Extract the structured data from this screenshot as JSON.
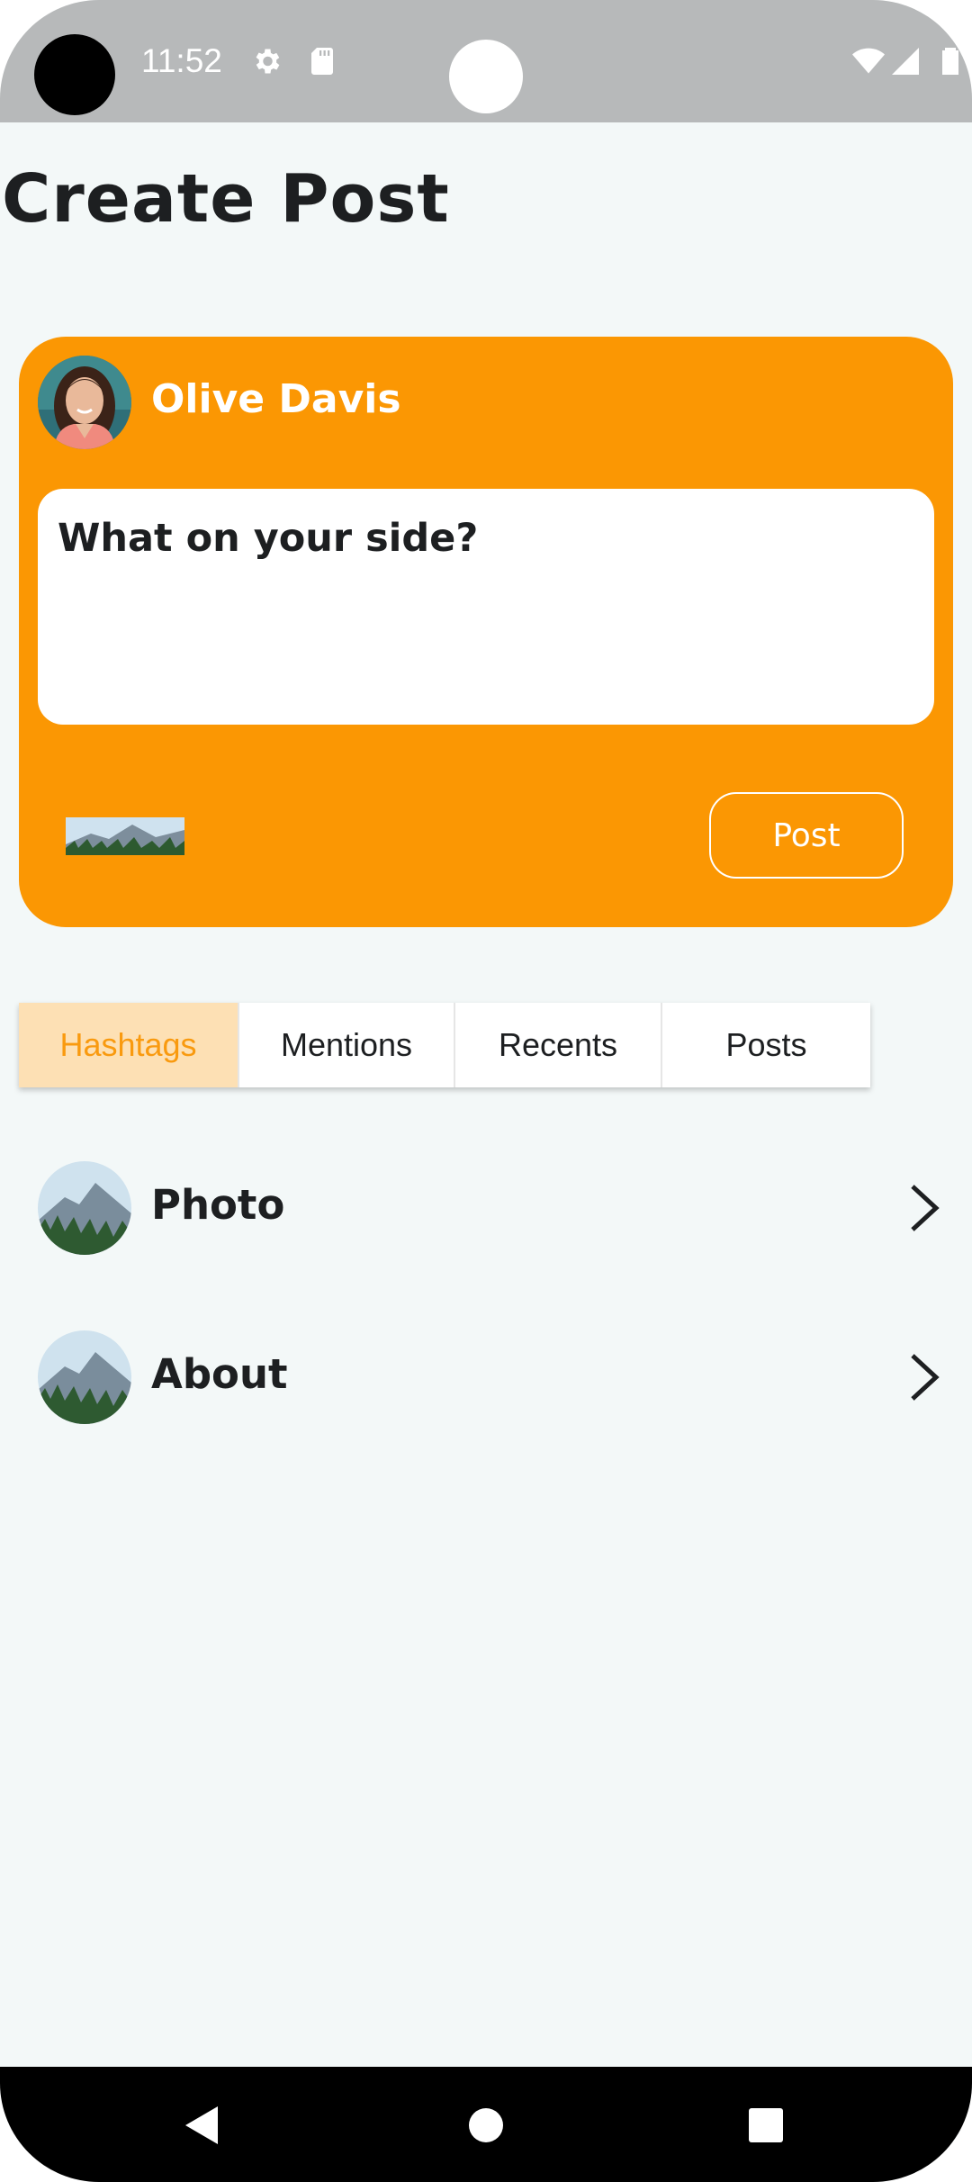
{
  "status_bar": {
    "time": "11:52",
    "icons": [
      "settings-icon",
      "sd-card-icon",
      "wifi-icon",
      "signal-icon",
      "battery-icon"
    ]
  },
  "page": {
    "title": "Create Post"
  },
  "composer": {
    "user_name": "Olive Davis",
    "input_text": "What on your side?",
    "post_label": "Post",
    "accent_color": "#fb9703"
  },
  "tabs": [
    {
      "label": "Hashtags",
      "active": true
    },
    {
      "label": "Mentions",
      "active": false
    },
    {
      "label": "Recents",
      "active": false
    },
    {
      "label": "Posts",
      "active": false
    }
  ],
  "list": [
    {
      "label": "Photo",
      "icon": "chevron-right-icon"
    },
    {
      "label": "About",
      "icon": "chevron-right-icon"
    }
  ],
  "nav_bar": {
    "icons": [
      "back-icon",
      "home-icon",
      "recents-icon"
    ]
  }
}
